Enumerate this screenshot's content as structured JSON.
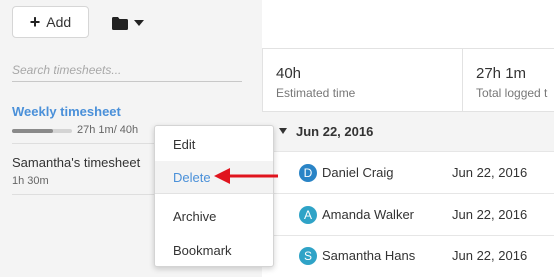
{
  "toolbar": {
    "add_label": "Add",
    "add_icon": "plus-icon",
    "folder_icon": "folder-icon",
    "dropdown_icon": "caret-down-icon"
  },
  "search": {
    "placeholder": "Search timesheets..."
  },
  "timesheets": [
    {
      "title": "Weekly timesheet",
      "meta": "27h 1m/ 40h",
      "progress": 0.68
    },
    {
      "title": "Samantha's timesheet",
      "meta": "1h 30m"
    }
  ],
  "stats": [
    {
      "value": "40h",
      "label": "Estimated time"
    },
    {
      "value": "27h 1m",
      "label": "Total logged t"
    }
  ],
  "group": {
    "date": "Jun 22, 2016"
  },
  "rows": [
    {
      "initial": "D",
      "name": "Daniel Craig",
      "date": "Jun 22, 2016",
      "color": "#2a84c6"
    },
    {
      "initial": "A",
      "name": "Amanda Walker",
      "date": "Jun 22, 2016",
      "color": "#2fa3c7"
    },
    {
      "initial": "S",
      "name": "Samantha Hans",
      "date": "Jun 22, 2016",
      "color": "#2fa3c7"
    }
  ],
  "context_menu": {
    "items": [
      "Edit",
      "Delete",
      "Archive",
      "Bookmark"
    ],
    "active": "Delete"
  },
  "colors": {
    "accent": "#4a90d9",
    "annotation_arrow": "#e0141e"
  }
}
